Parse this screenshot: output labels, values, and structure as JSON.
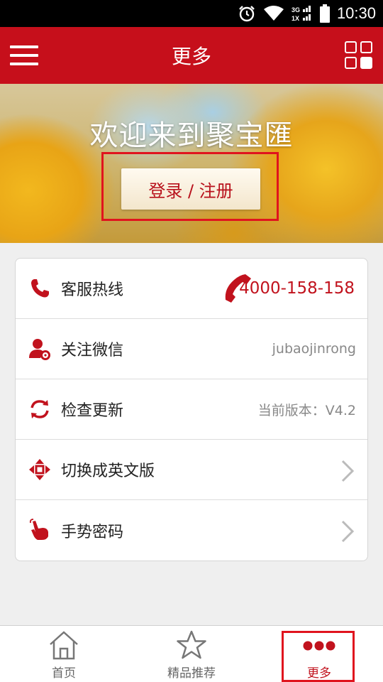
{
  "status_bar": {
    "time": "10:30",
    "network": "3G 1X",
    "icons": [
      "alarm-icon",
      "wifi-icon",
      "signal-icon",
      "battery-icon"
    ]
  },
  "header": {
    "title": "更多",
    "left_icon": "menu-icon",
    "right_icon": "grid-icon"
  },
  "banner": {
    "welcome_text": "欢迎来到聚宝匯",
    "login_label": "登录 / 注册"
  },
  "settings": {
    "items": [
      {
        "label": "客服热线",
        "value": "4000-158-158",
        "icon": "phone-icon"
      },
      {
        "label": "关注微信",
        "value": "jubaojinrong",
        "icon": "user-settings-icon"
      },
      {
        "label": "检查更新",
        "value": "当前版本：V4.2",
        "icon": "refresh-icon"
      },
      {
        "label": "切换成英文版",
        "value": "",
        "icon": "move-arrows-icon"
      },
      {
        "label": "手势密码",
        "value": "",
        "icon": "hand-gesture-icon"
      }
    ]
  },
  "bottom_nav": {
    "items": [
      {
        "label": "首页",
        "icon": "home-icon"
      },
      {
        "label": "精品推荐",
        "icon": "star-icon"
      },
      {
        "label": "更多",
        "icon": "more-dots-icon"
      }
    ],
    "active_index": 2
  },
  "colors": {
    "brand_red": "#c60f1b",
    "highlight_red": "#e0141e",
    "text_dark": "#222222",
    "text_gray": "#888888"
  }
}
